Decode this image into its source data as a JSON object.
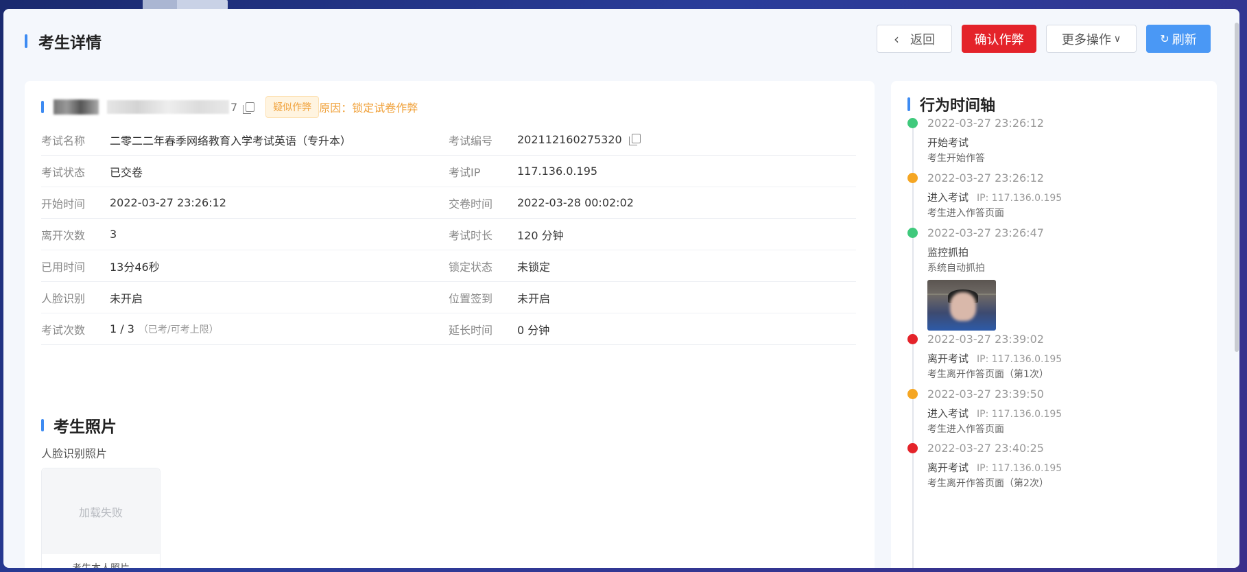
{
  "header": {
    "title": "考生详情",
    "back_label": "返回",
    "confirm_label": "确认作弊",
    "more_label": "更多操作",
    "refresh_label": "刷新"
  },
  "candidate": {
    "id_tail": "7",
    "tag": "疑似作弊",
    "reason": "原因：锁定试卷作弊"
  },
  "info_rows": [
    {
      "l1": "考试名称",
      "v1": "二零二二年春季网络教育入学考试英语（专升本）",
      "l2": "考试编号",
      "v2": "202112160275320"
    },
    {
      "l1": "考试状态",
      "v1": "已交卷",
      "l2": "考试IP",
      "v2": "117.136.0.195"
    },
    {
      "l1": "开始时间",
      "v1": "2022-03-27 23:26:12",
      "l2": "交卷时间",
      "v2": "2022-03-28 00:02:02"
    },
    {
      "l1": "离开次数",
      "v1": "3",
      "l2": "考试时长",
      "v2": "120 分钟"
    },
    {
      "l1": "已用时间",
      "v1": "13分46秒",
      "l2": "锁定状态",
      "v2": "未锁定"
    },
    {
      "l1": "人脸识别",
      "v1": "未开启",
      "l2": "位置签到",
      "v2": "未开启"
    },
    {
      "l1": "考试次数",
      "v1": "1 / 3",
      "v1_sub": "（已考/可考上限）",
      "l2": "延长时间",
      "v2": "0 分钟"
    }
  ],
  "photos": {
    "title": "考生照片",
    "subtitle": "人脸识别照片",
    "fail_text": "加载失败",
    "caption": "考生本人照片"
  },
  "timeline": {
    "title": "行为时间轴",
    "items": [
      {
        "time": "2022-03-27 23:26:12",
        "action": "开始考试",
        "ip": "",
        "desc": "考生开始作答",
        "color": "#3fc97c"
      },
      {
        "time": "2022-03-27 23:26:12",
        "action": "进入考试",
        "ip": "IP: 117.136.0.195",
        "desc": "考生进入作答页面",
        "color": "#f5a623"
      },
      {
        "time": "2022-03-27 23:26:47",
        "action": "监控抓拍",
        "ip": "",
        "desc": "系统自动抓拍",
        "color": "#3fc97c"
      },
      {
        "time": "2022-03-27 23:39:02",
        "action": "离开考试",
        "ip": "IP: 117.136.0.195",
        "desc": "考生离开作答页面（第1次）",
        "color": "#e4232a"
      },
      {
        "time": "2022-03-27 23:39:50",
        "action": "进入考试",
        "ip": "IP: 117.136.0.195",
        "desc": "考生进入作答页面",
        "color": "#f5a623"
      },
      {
        "time": "2022-03-27 23:40:25",
        "action": "离开考试",
        "ip": "IP: 117.136.0.195",
        "desc": "考生离开作答页面（第2次）",
        "color": "#e4232a"
      }
    ]
  }
}
